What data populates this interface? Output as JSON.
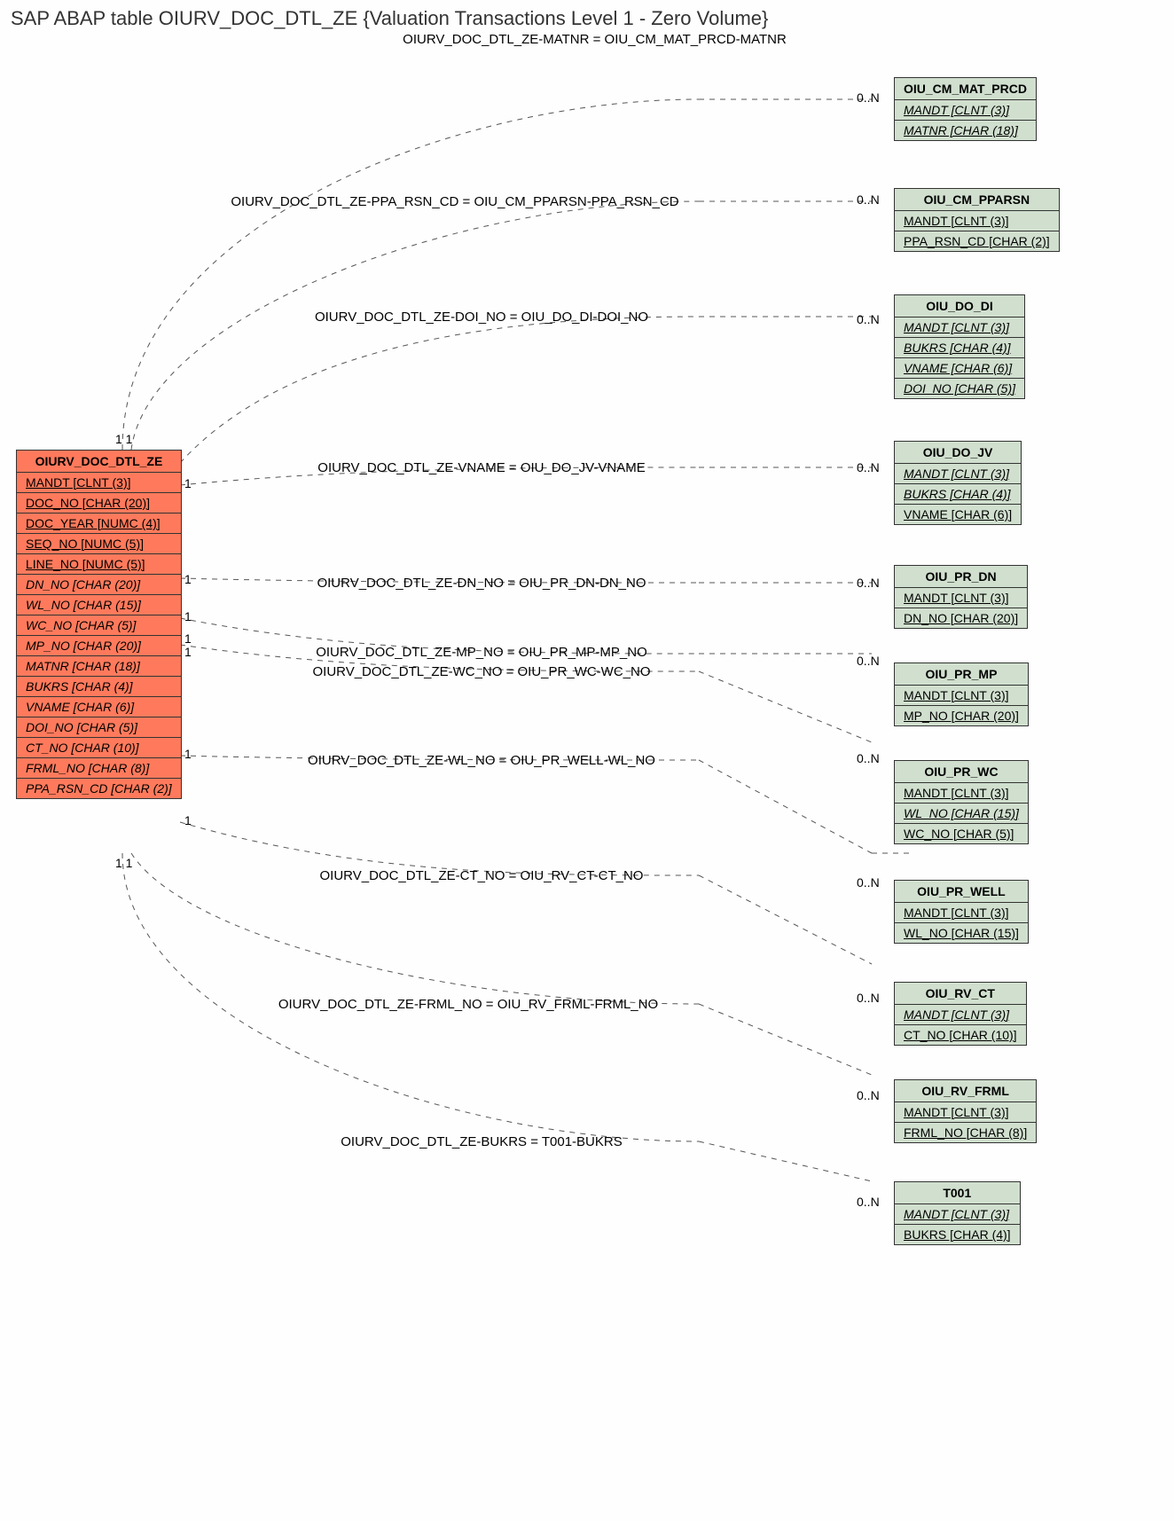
{
  "title": "SAP ABAP table OIURV_DOC_DTL_ZE {Valuation Transactions Level 1 - Zero Volume}",
  "subtitle": "OIURV_DOC_DTL_ZE-MATNR = OIU_CM_MAT_PRCD-MATNR",
  "source_entity": {
    "name": "OIURV_DOC_DTL_ZE",
    "fields": [
      {
        "text": "MANDT [CLNT (3)]",
        "u": true,
        "i": false
      },
      {
        "text": "DOC_NO [CHAR (20)]",
        "u": true,
        "i": false
      },
      {
        "text": "DOC_YEAR [NUMC (4)]",
        "u": true,
        "i": false
      },
      {
        "text": "SEQ_NO [NUMC (5)]",
        "u": true,
        "i": false
      },
      {
        "text": "LINE_NO [NUMC (5)]",
        "u": true,
        "i": false
      },
      {
        "text": "DN_NO [CHAR (20)]",
        "u": false,
        "i": true
      },
      {
        "text": "WL_NO [CHAR (15)]",
        "u": false,
        "i": true
      },
      {
        "text": "WC_NO [CHAR (5)]",
        "u": false,
        "i": true
      },
      {
        "text": "MP_NO [CHAR (20)]",
        "u": false,
        "i": true
      },
      {
        "text": "MATNR [CHAR (18)]",
        "u": false,
        "i": true
      },
      {
        "text": "BUKRS [CHAR (4)]",
        "u": false,
        "i": true
      },
      {
        "text": "VNAME [CHAR (6)]",
        "u": false,
        "i": true
      },
      {
        "text": "DOI_NO [CHAR (5)]",
        "u": false,
        "i": true
      },
      {
        "text": "CT_NO [CHAR (10)]",
        "u": false,
        "i": true
      },
      {
        "text": "FRML_NO [CHAR (8)]",
        "u": false,
        "i": true
      },
      {
        "text": "PPA_RSN_CD [CHAR (2)]",
        "u": false,
        "i": true
      }
    ]
  },
  "targets": [
    {
      "name": "OIU_CM_MAT_PRCD",
      "fields": [
        {
          "text": "MANDT [CLNT (3)]",
          "u": true,
          "i": true
        },
        {
          "text": "MATNR [CHAR (18)]",
          "u": true,
          "i": true
        }
      ]
    },
    {
      "name": "OIU_CM_PPARSN",
      "fields": [
        {
          "text": "MANDT [CLNT (3)]",
          "u": true,
          "i": false
        },
        {
          "text": "PPA_RSN_CD [CHAR (2)]",
          "u": true,
          "i": false
        }
      ]
    },
    {
      "name": "OIU_DO_DI",
      "fields": [
        {
          "text": "MANDT [CLNT (3)]",
          "u": true,
          "i": true
        },
        {
          "text": "BUKRS [CHAR (4)]",
          "u": true,
          "i": true
        },
        {
          "text": "VNAME [CHAR (6)]",
          "u": true,
          "i": true
        },
        {
          "text": "DOI_NO [CHAR (5)]",
          "u": true,
          "i": true
        }
      ]
    },
    {
      "name": "OIU_DO_JV",
      "fields": [
        {
          "text": "MANDT [CLNT (3)]",
          "u": true,
          "i": true
        },
        {
          "text": "BUKRS [CHAR (4)]",
          "u": true,
          "i": true
        },
        {
          "text": "VNAME [CHAR (6)]",
          "u": true,
          "i": false
        }
      ]
    },
    {
      "name": "OIU_PR_DN",
      "fields": [
        {
          "text": "MANDT [CLNT (3)]",
          "u": true,
          "i": false
        },
        {
          "text": "DN_NO [CHAR (20)]",
          "u": true,
          "i": false
        }
      ]
    },
    {
      "name": "OIU_PR_MP",
      "fields": [
        {
          "text": "MANDT [CLNT (3)]",
          "u": true,
          "i": false
        },
        {
          "text": "MP_NO [CHAR (20)]",
          "u": true,
          "i": false
        }
      ]
    },
    {
      "name": "OIU_PR_WC",
      "fields": [
        {
          "text": "MANDT [CLNT (3)]",
          "u": true,
          "i": false
        },
        {
          "text": "WL_NO [CHAR (15)]",
          "u": true,
          "i": true
        },
        {
          "text": "WC_NO [CHAR (5)]",
          "u": true,
          "i": false
        }
      ]
    },
    {
      "name": "OIU_PR_WELL",
      "fields": [
        {
          "text": "MANDT [CLNT (3)]",
          "u": true,
          "i": false
        },
        {
          "text": "WL_NO [CHAR (15)]",
          "u": true,
          "i": false
        }
      ]
    },
    {
      "name": "OIU_RV_CT",
      "fields": [
        {
          "text": "MANDT [CLNT (3)]",
          "u": true,
          "i": true
        },
        {
          "text": "CT_NO [CHAR (10)]",
          "u": true,
          "i": false
        }
      ]
    },
    {
      "name": "OIU_RV_FRML",
      "fields": [
        {
          "text": "MANDT [CLNT (3)]",
          "u": true,
          "i": false
        },
        {
          "text": "FRML_NO [CHAR (8)]",
          "u": true,
          "i": false
        }
      ]
    },
    {
      "name": "T001",
      "fields": [
        {
          "text": "MANDT [CLNT (3)]",
          "u": true,
          "i": true
        },
        {
          "text": "BUKRS [CHAR (4)]",
          "u": true,
          "i": false
        }
      ]
    }
  ],
  "relations": [
    {
      "label": "OIURV_DOC_DTL_ZE-PPA_RSN_CD = OIU_CM_PPARSN-PPA_RSN_CD"
    },
    {
      "label": "OIURV_DOC_DTL_ZE-DOI_NO = OIU_DO_DI-DOI_NO"
    },
    {
      "label": "OIURV_DOC_DTL_ZE-VNAME = OIU_DO_JV-VNAME"
    },
    {
      "label": "OIURV_DOC_DTL_ZE-DN_NO = OIU_PR_DN-DN_NO"
    },
    {
      "label": "OIURV_DOC_DTL_ZE-MP_NO = OIU_PR_MP-MP_NO"
    },
    {
      "label": "OIURV_DOC_DTL_ZE-WC_NO = OIU_PR_WC-WC_NO"
    },
    {
      "label": "OIURV_DOC_DTL_ZE-WL_NO = OIU_PR_WELL-WL_NO"
    },
    {
      "label": "OIURV_DOC_DTL_ZE-CT_NO = OIU_RV_CT-CT_NO"
    },
    {
      "label": "OIURV_DOC_DTL_ZE-FRML_NO = OIU_RV_FRML-FRML_NO"
    },
    {
      "label": "OIURV_DOC_DTL_ZE-BUKRS = T001-BUKRS"
    }
  ],
  "cardinality": {
    "one": "1",
    "zero_n": "0..N",
    "one_one_a": "1 1",
    "one_one_b": "1 1"
  }
}
